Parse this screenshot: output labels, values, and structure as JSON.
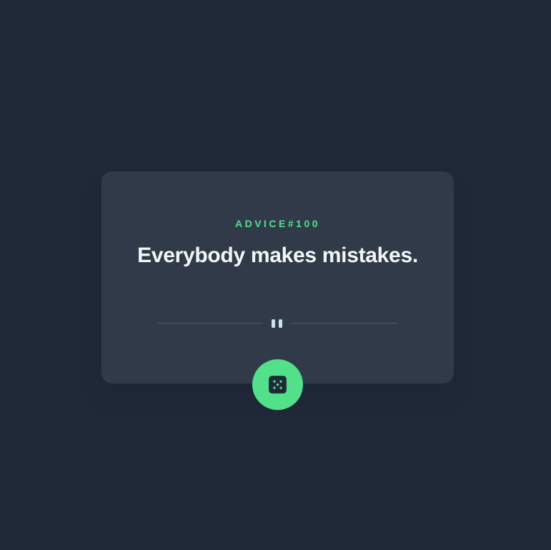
{
  "advice": {
    "label": "ADVICE",
    "separator": "#",
    "number": "100",
    "text": "Everybody makes mistakes."
  },
  "divider": {
    "icon": "pause-icon"
  },
  "button": {
    "icon": "dice-icon",
    "accent_color": "#52E08A"
  },
  "colors": {
    "background": "#202938",
    "card": "#313A49",
    "accent": "#52E08A",
    "quote_text": "#F2F6FB",
    "divider_line": "#4F5D74"
  }
}
